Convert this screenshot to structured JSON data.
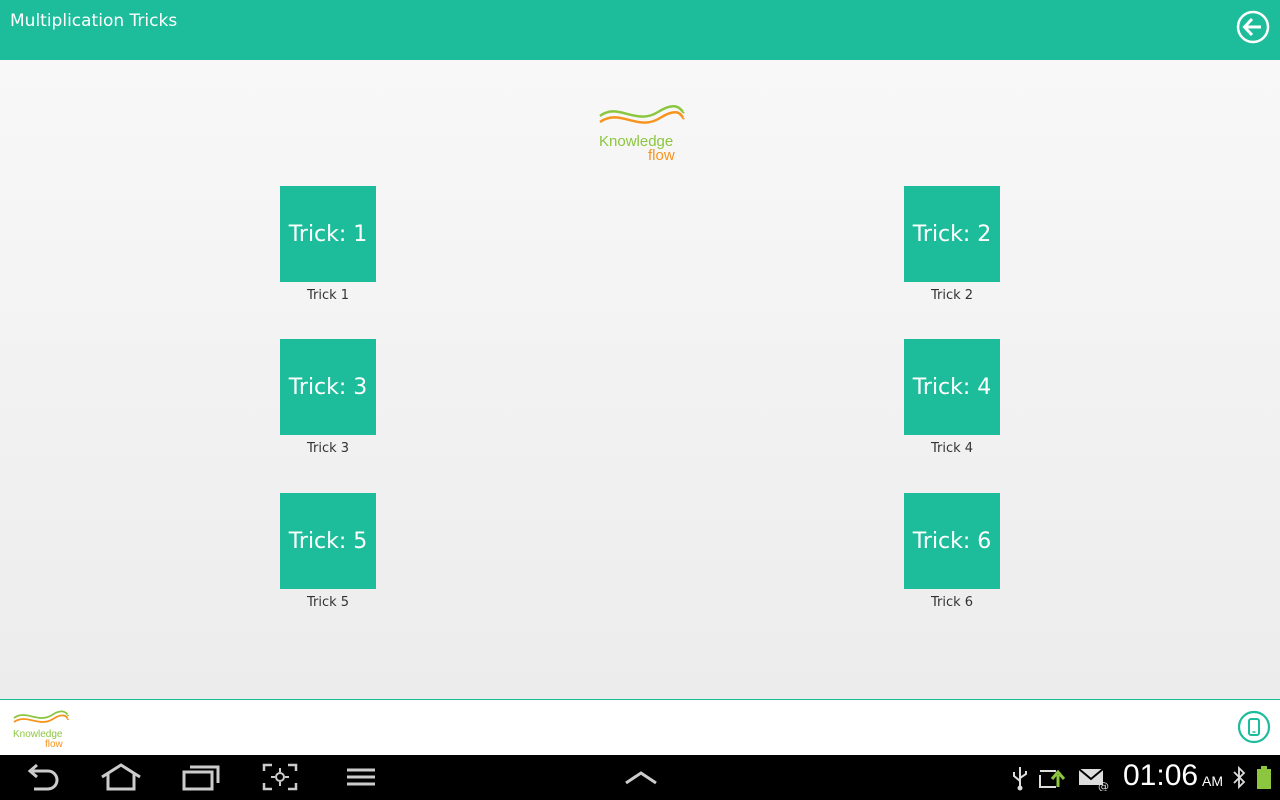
{
  "header": {
    "title": "Multiplication Tricks",
    "back_icon": "arrow-left-circle-icon"
  },
  "logo": {
    "line1": "Knowledge",
    "line2": "flow",
    "colors": {
      "green": "#8cc63f",
      "orange": "#f7941d"
    }
  },
  "tricks": [
    {
      "tile": "Trick: 1",
      "caption": "Trick 1"
    },
    {
      "tile": "Trick: 2",
      "caption": "Trick 2"
    },
    {
      "tile": "Trick: 3",
      "caption": "Trick 3"
    },
    {
      "tile": "Trick: 4",
      "caption": "Trick 4"
    },
    {
      "tile": "Trick: 5",
      "caption": "Trick 5"
    },
    {
      "tile": "Trick: 6",
      "caption": "Trick 6"
    }
  ],
  "footer": {
    "phone_icon": "phone-icon"
  },
  "system_bar": {
    "time": "01:06",
    "ampm": "AM",
    "nav_icons": [
      "back-icon",
      "home-icon",
      "recent-apps-icon",
      "screenshot-icon",
      "menu-icon",
      "chevron-up-icon"
    ],
    "status_icons": [
      "usb-icon",
      "sync-icon",
      "email-icon",
      "bluetooth-icon",
      "battery-icon"
    ]
  },
  "colors": {
    "accent": "#1dbd9c",
    "system_bar": "#000000"
  }
}
